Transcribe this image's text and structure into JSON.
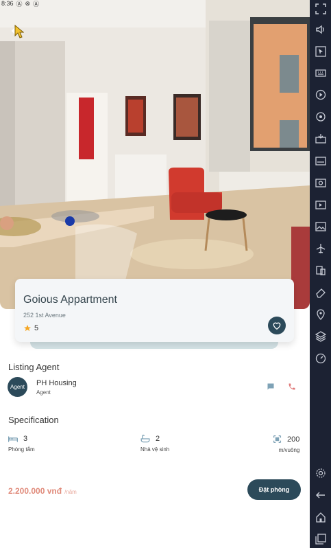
{
  "status_bar": {
    "time": "8:36",
    "icons": [
      "app-a-icon",
      "app-x-icon",
      "app-a2-icon"
    ]
  },
  "listing": {
    "title": "Goious Appartment",
    "address": "252 1st Avenue",
    "rating": "5"
  },
  "agent_section": {
    "heading": "Listing Agent",
    "avatar_text": "Agent",
    "name": "PH Housing",
    "role": "Agent"
  },
  "spec_section": {
    "heading": "Specification",
    "items": [
      {
        "icon": "bed-icon",
        "value": "3",
        "label": "Phòng tắm"
      },
      {
        "icon": "bathtub-icon",
        "value": "2",
        "label": "Nhà vệ sinh"
      },
      {
        "icon": "area-icon",
        "value": "200",
        "label": "m/vuông"
      }
    ]
  },
  "price": {
    "amount": "2.200.000 vnđ",
    "unit": "/năm"
  },
  "book_button": {
    "label": "Đặt phòng"
  },
  "colors": {
    "accent": "#2c4a5a",
    "price": "#e08a7a",
    "star": "#f5a623",
    "emulator_bar": "#1c2233"
  },
  "emulator_toolbar": [
    "fullscreen-icon",
    "volume-icon",
    "pointer-icon",
    "keyboard-icon",
    "record-icon",
    "rotate-icon",
    "apk-install-icon",
    "apk-icon",
    "screenshot-icon",
    "screen-record-icon",
    "gallery-icon",
    "airplane-icon",
    "multi-instance-icon",
    "eraser-icon",
    "location-icon",
    "layers-icon",
    "speed-icon",
    "settings-icon",
    "back-icon",
    "home-icon",
    "recents-icon"
  ]
}
